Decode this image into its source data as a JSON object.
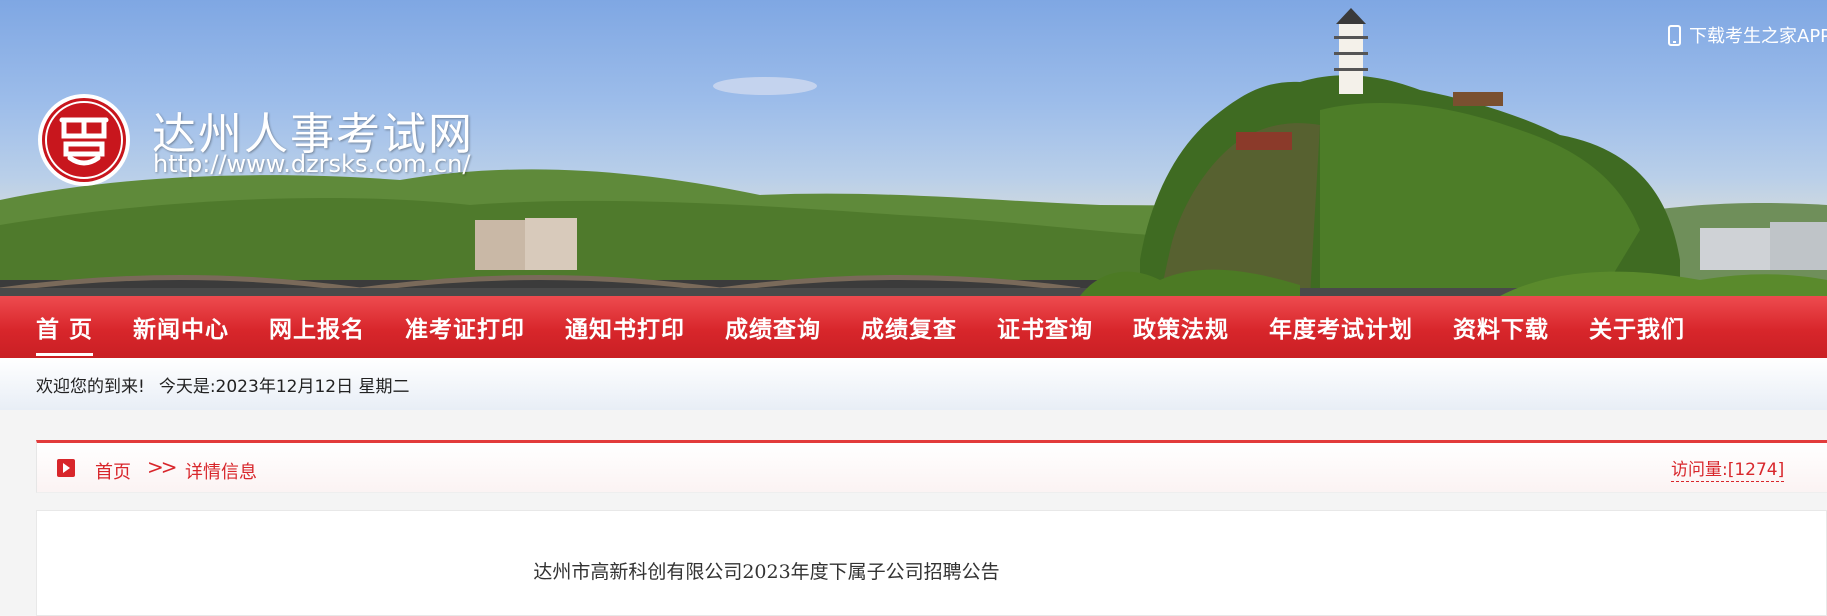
{
  "header": {
    "site_title": "达州人事考试网",
    "site_url": "http://www.dzrsks.com.cn/",
    "app_download": "下载考生之家APP",
    "logo_icon": "seal-logo-icon"
  },
  "nav": {
    "items": [
      {
        "label": "首 页",
        "active": true
      },
      {
        "label": "新闻中心"
      },
      {
        "label": "网上报名"
      },
      {
        "label": "准考证打印"
      },
      {
        "label": "通知书打印"
      },
      {
        "label": "成绩查询"
      },
      {
        "label": "成绩复查"
      },
      {
        "label": "证书查询"
      },
      {
        "label": "政策法规"
      },
      {
        "label": "年度考试计划"
      },
      {
        "label": "资料下载"
      },
      {
        "label": "关于我们"
      }
    ]
  },
  "welcome": {
    "greeting": "欢迎您的到来!",
    "today": "今天是:2023年12月12日 星期二"
  },
  "breadcrumb": {
    "home": "首页",
    "separator": ">>",
    "current": "详情信息",
    "visits": "访问量:[1274]"
  },
  "article": {
    "title": "达州市高新科创有限公司2023年度下属子公司招聘公告"
  },
  "colors": {
    "brand_red": "#d8262b",
    "sky": "#8fb3e6"
  }
}
